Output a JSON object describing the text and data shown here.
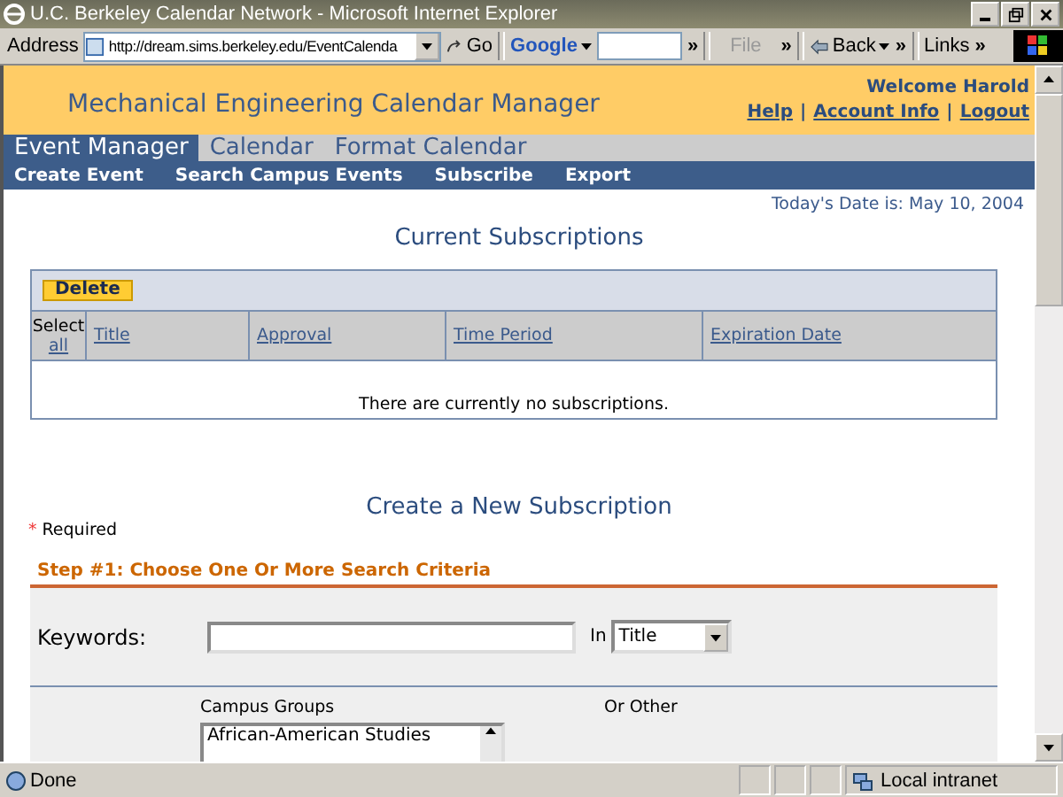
{
  "window": {
    "title": "U.C. Berkeley Calendar Network - Microsoft Internet Explorer"
  },
  "toolbar": {
    "address_label": "Address",
    "address": "http://dream.sims.berkeley.edu/EventCalenda",
    "go": "Go",
    "google": "Google",
    "chevron": "»",
    "file": "File",
    "back": "Back",
    "links": "Links"
  },
  "header": {
    "title": "Mechanical Engineering Calendar Manager",
    "welcome": "Welcome Harold",
    "links": [
      "Help",
      "Account Info",
      "Logout"
    ],
    "separator": "|"
  },
  "tabs": [
    {
      "label": "Event Manager",
      "selected": true
    },
    {
      "label": "Calendar",
      "selected": false
    },
    {
      "label": "Format Calendar",
      "selected": false
    }
  ],
  "subnav": [
    "Create Event",
    "Search Campus Events",
    "Subscribe",
    "Export"
  ],
  "date": "Today's Date is: May 10, 2004",
  "subscriptions": {
    "heading": "Current Subscriptions",
    "delete": "Delete",
    "select": "Select",
    "select_all": "all",
    "columns": [
      "Title",
      "Approval",
      "Time Period",
      "Expiration Date"
    ],
    "empty": "There are currently no subscriptions."
  },
  "create": {
    "heading": "Create a New Subscription",
    "required_mark": "*",
    "required": "Required",
    "step": "Step #1: Choose One Or More Search Criteria",
    "keywords_label": "Keywords:",
    "in_label": "In",
    "in_value": "Title",
    "groups_label": "Campus Groups",
    "other_label": "Or Other",
    "groups": [
      "African-American Studies"
    ]
  },
  "status_bar": {
    "text": "Done",
    "zone": "Local intranet"
  }
}
